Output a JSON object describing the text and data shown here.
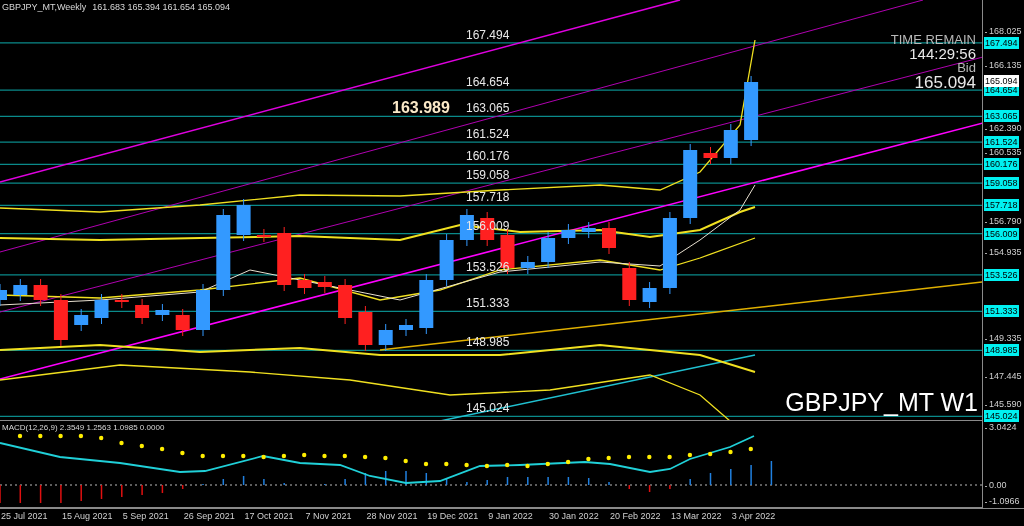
{
  "header": {
    "symbol": "GBPJPY_MT,Weekly",
    "ohlc": "161.683 165.394 161.654 165.094"
  },
  "time_remain": {
    "label": "TIME REMAIN",
    "value": "144:29:56"
  },
  "bid": {
    "label": "Bid",
    "value": "165.094",
    "tag": "165.094"
  },
  "marker_label": "163.989",
  "symbol_label": "GBPJPY_MT W1",
  "levels": [
    {
      "label": "167.494",
      "tag": "167.494"
    },
    {
      "label": "164.654",
      "tag": "164.654"
    },
    {
      "label": "163.065",
      "tag": "163.065"
    },
    {
      "label": "161.524",
      "tag": "161.524"
    },
    {
      "label": "160.176",
      "tag": "160.176"
    },
    {
      "label": "159.058",
      "tag": "159.058"
    },
    {
      "label": "157.718",
      "tag": "157.718"
    },
    {
      "label": "156.009",
      "tag": "156.009"
    },
    {
      "label": "153.526",
      "tag": "153.526"
    },
    {
      "label": "151.333",
      "tag": "151.333"
    },
    {
      "label": "148.985",
      "tag": "148.985"
    },
    {
      "label": "145.024",
      "tag": "145.024"
    }
  ],
  "price_scale": [
    "168.025",
    "166.135",
    "162.390",
    "160.535",
    "156.790",
    "154.935",
    "149.335",
    "147.445",
    "145.590"
  ],
  "macd": {
    "label": "MACD(12,26,9) 2.3549 1.2563 1.0985 0.0000",
    "scale": [
      "3.0424",
      "0.00",
      "-1.0966"
    ]
  },
  "dates": [
    "25 Jul 2021",
    "15 Aug 2021",
    "5 Sep 2021",
    "26 Sep 2021",
    "17 Oct 2021",
    "7 Nov 2021",
    "28 Nov 2021",
    "19 Dec 2021",
    "9 Jan 2022",
    "30 Jan 2022",
    "20 Feb 2022",
    "13 Mar 2022",
    "3 Apr 2022"
  ]
}
